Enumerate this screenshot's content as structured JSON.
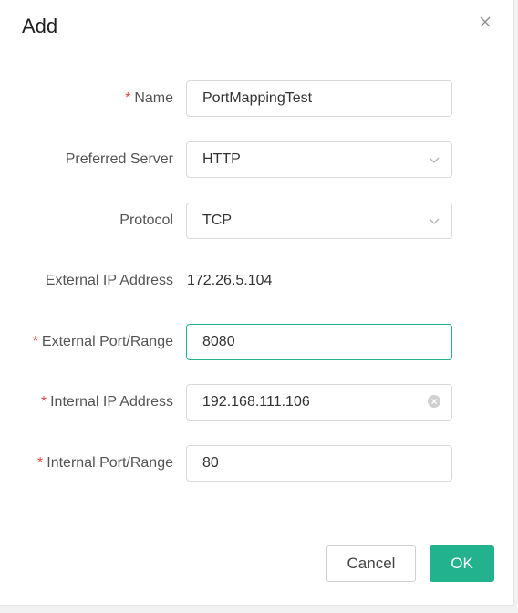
{
  "dialog": {
    "title": "Add",
    "close_icon": "close-icon"
  },
  "form": {
    "name": {
      "label": "Name",
      "required": "*",
      "value": "PortMappingTest"
    },
    "preferred_server": {
      "label": "Preferred Server",
      "value": "HTTP"
    },
    "protocol": {
      "label": "Protocol",
      "value": "TCP"
    },
    "external_ip": {
      "label": "External IP Address",
      "value": "172.26.5.104"
    },
    "external_port": {
      "label": "External Port/Range",
      "required": "*",
      "value": "8080"
    },
    "internal_ip": {
      "label": "Internal IP Address",
      "required": "*",
      "value": "192.168.111.106"
    },
    "internal_port": {
      "label": "Internal Port/Range",
      "required": "*",
      "value": "80"
    }
  },
  "footer": {
    "cancel_label": "Cancel",
    "ok_label": "OK"
  },
  "colors": {
    "accent": "#23b28e",
    "required": "#e64545"
  }
}
